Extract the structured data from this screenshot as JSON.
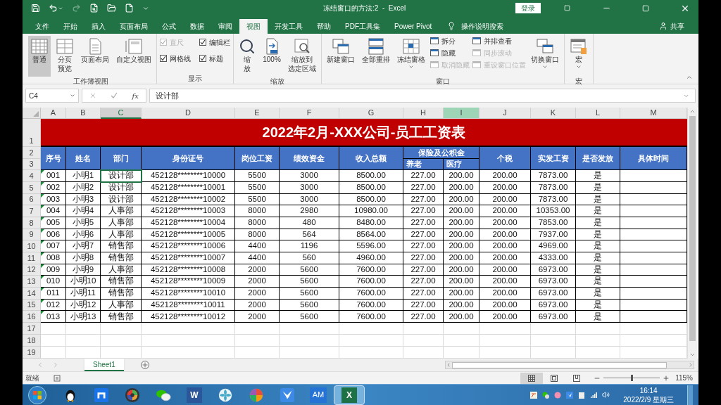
{
  "title_bar": {
    "title": "冻结窗口的方法:2  -  Excel",
    "login": "登录"
  },
  "ribbon_tabs": [
    {
      "label": "文件",
      "selected": false
    },
    {
      "label": "开始",
      "selected": false
    },
    {
      "label": "插入",
      "selected": false
    },
    {
      "label": "页面布局",
      "selected": false
    },
    {
      "label": "公式",
      "selected": false
    },
    {
      "label": "数据",
      "selected": false
    },
    {
      "label": "审阅",
      "selected": false
    },
    {
      "label": "视图",
      "selected": true
    },
    {
      "label": "开发工具",
      "selected": false
    },
    {
      "label": "帮助",
      "selected": false
    },
    {
      "label": "PDF工具集",
      "selected": false
    },
    {
      "label": "Power Pivot",
      "selected": false
    }
  ],
  "tell_me": "操作说明搜索",
  "share": "共享",
  "ribbon_groups": [
    {
      "label": "工作簿视图",
      "items": [
        {
          "kind": "large",
          "lines": [
            "普通"
          ],
          "selected": true
        },
        {
          "kind": "large",
          "lines": [
            "分页",
            "预览"
          ],
          "selected": false
        },
        {
          "kind": "large",
          "lines": [
            "页面布局"
          ],
          "selected": false
        },
        {
          "kind": "large",
          "lines": [
            "自定义视图"
          ],
          "selected": false
        }
      ]
    },
    {
      "label": "显示",
      "items": [
        {
          "kind": "check",
          "label": "直尺",
          "checked": true,
          "disabled": true
        },
        {
          "kind": "check",
          "label": "网格线",
          "checked": true,
          "disabled": false
        },
        {
          "kind": "check",
          "label": "编辑栏",
          "checked": true,
          "disabled": false
        },
        {
          "kind": "check",
          "label": "标题",
          "checked": true,
          "disabled": false
        }
      ]
    },
    {
      "label": "缩放",
      "items": [
        {
          "kind": "large",
          "lines": [
            "缩",
            "放"
          ],
          "selected": false
        },
        {
          "kind": "large",
          "lines": [
            "100%"
          ],
          "selected": false
        },
        {
          "kind": "large",
          "lines": [
            "缩放到",
            "选定区域"
          ],
          "selected": false
        }
      ]
    },
    {
      "label": "窗口",
      "items": [
        {
          "kind": "large",
          "lines": [
            "新建窗口"
          ],
          "selected": false
        },
        {
          "kind": "large",
          "lines": [
            "全部重排"
          ],
          "selected": false
        },
        {
          "kind": "large",
          "lines": [
            "冻结窗格"
          ],
          "selected": false,
          "dropdown": true
        },
        {
          "kind": "small",
          "label": "拆分",
          "disabled": false
        },
        {
          "kind": "small",
          "label": "隐藏",
          "disabled": false
        },
        {
          "kind": "small",
          "label": "取消隐藏",
          "disabled": true
        },
        {
          "kind": "small2",
          "label": "并排查看",
          "disabled": false
        },
        {
          "kind": "small2",
          "label": "同步滚动",
          "disabled": true
        },
        {
          "kind": "small2",
          "label": "重设窗口位置",
          "disabled": true
        },
        {
          "kind": "large",
          "lines": [
            "切换窗口"
          ],
          "selected": false,
          "dropdown": true
        }
      ]
    },
    {
      "label": "宏",
      "items": [
        {
          "kind": "large",
          "lines": [
            "宏"
          ],
          "selected": false,
          "dropdown": true
        }
      ]
    }
  ],
  "formula_bar": {
    "name_box": "C4",
    "function_label": "fx",
    "formula": "设计部"
  },
  "columns": [
    {
      "label": "A",
      "selected": false,
      "highlighted": false
    },
    {
      "label": "B",
      "selected": false,
      "highlighted": false
    },
    {
      "label": "C",
      "selected": true,
      "highlighted": false
    },
    {
      "label": "D",
      "selected": false,
      "highlighted": false
    },
    {
      "label": "E",
      "selected": false,
      "highlighted": false
    },
    {
      "label": "F",
      "selected": false,
      "highlighted": false
    },
    {
      "label": "G",
      "selected": false,
      "highlighted": false
    },
    {
      "label": "H",
      "selected": false,
      "highlighted": false
    },
    {
      "label": "I",
      "selected": false,
      "highlighted": true
    },
    {
      "label": "J",
      "selected": false,
      "highlighted": false
    },
    {
      "label": "K",
      "selected": false,
      "highlighted": false
    },
    {
      "label": "L",
      "selected": false,
      "highlighted": false
    },
    {
      "label": "M",
      "selected": false,
      "highlighted": false
    }
  ],
  "row_numbers": [
    "1",
    "2",
    "3",
    "4",
    "5",
    "6",
    "7",
    "8",
    "9",
    "10",
    "11",
    "12",
    "13",
    "14",
    "15",
    "16",
    "17",
    "18",
    "19"
  ],
  "sheet_title": "2022年2月-XXX公司-员工工资表",
  "header": [
    {
      "label": "序号"
    },
    {
      "label": "姓名"
    },
    {
      "label": "部门"
    },
    {
      "label": "身份证号"
    },
    {
      "label": "岗位工资"
    },
    {
      "label": "绩效资金"
    },
    {
      "label": "收入总额"
    },
    {
      "label": "保险及公积金",
      "children": [
        {
          "label": "养老"
        },
        {
          "label": "医疗"
        }
      ]
    },
    {
      "label": "个税"
    },
    {
      "label": "实发工资"
    },
    {
      "label": "是否发放"
    },
    {
      "label": "具体时间"
    }
  ],
  "rows": [
    {
      "selected": true,
      "flagged": true,
      "cells": [
        "001",
        "小明1",
        "设计部",
        "452128********10000",
        "5500",
        "3000",
        "8500.00",
        "227.00",
        "200.00",
        "200.00",
        "7873.00",
        "是"
      ]
    },
    {
      "selected": false,
      "flagged": true,
      "cells": [
        "002",
        "小明2",
        "设计部",
        "452128********10001",
        "5500",
        "3000",
        "8500.00",
        "227.00",
        "200.00",
        "200.00",
        "7873.00",
        "是"
      ]
    },
    {
      "selected": false,
      "flagged": true,
      "cells": [
        "003",
        "小明3",
        "设计部",
        "452128********10002",
        "5500",
        "3000",
        "8500.00",
        "227.00",
        "200.00",
        "200.00",
        "7873.00",
        "是"
      ]
    },
    {
      "selected": false,
      "flagged": true,
      "cells": [
        "004",
        "小明4",
        "人事部",
        "452128********10003",
        "8000",
        "2980",
        "10980.00",
        "227.00",
        "200.00",
        "200.00",
        "10353.00",
        "是"
      ]
    },
    {
      "selected": false,
      "flagged": true,
      "cells": [
        "005",
        "小明5",
        "人事部",
        "452128********10004",
        "8000",
        "480",
        "8480.00",
        "227.00",
        "200.00",
        "200.00",
        "7853.00",
        "是"
      ]
    },
    {
      "selected": false,
      "flagged": true,
      "cells": [
        "006",
        "小明6",
        "人事部",
        "452128********10005",
        "8000",
        "564",
        "8564.00",
        "227.00",
        "200.00",
        "200.00",
        "7937.00",
        "是"
      ]
    },
    {
      "selected": false,
      "flagged": true,
      "cells": [
        "007",
        "小明7",
        "销售部",
        "452128********10006",
        "4400",
        "1196",
        "5596.00",
        "227.00",
        "200.00",
        "200.00",
        "4969.00",
        "是"
      ]
    },
    {
      "selected": false,
      "flagged": true,
      "cells": [
        "008",
        "小明8",
        "销售部",
        "452128********10007",
        "4400",
        "560",
        "4960.00",
        "227.00",
        "200.00",
        "200.00",
        "4333.00",
        "是"
      ]
    },
    {
      "selected": false,
      "flagged": true,
      "cells": [
        "009",
        "小明9",
        "人事部",
        "452128********10008",
        "2000",
        "5600",
        "7600.00",
        "227.00",
        "200.00",
        "200.00",
        "6973.00",
        "是"
      ]
    },
    {
      "selected": false,
      "flagged": true,
      "cells": [
        "010",
        "小明10",
        "销售部",
        "452128********10009",
        "2000",
        "5600",
        "7600.00",
        "227.00",
        "200.00",
        "200.00",
        "6973.00",
        "是"
      ]
    },
    {
      "selected": false,
      "flagged": true,
      "cells": [
        "011",
        "小明11",
        "销售部",
        "452128********10010",
        "2000",
        "5600",
        "7600.00",
        "227.00",
        "200.00",
        "200.00",
        "6973.00",
        "是"
      ]
    },
    {
      "selected": false,
      "flagged": true,
      "cells": [
        "012",
        "小明12",
        "人事部",
        "452128********10011",
        "2000",
        "5600",
        "7600.00",
        "227.00",
        "200.00",
        "200.00",
        "6973.00",
        "是"
      ]
    },
    {
      "selected": false,
      "flagged": true,
      "cells": [
        "013",
        "小明13",
        "销售部",
        "452128********10012",
        "2000",
        "5600",
        "7600.00",
        "227.00",
        "200.00",
        "200.00",
        "6973.00",
        "是"
      ]
    }
  ],
  "sheet_tabs": [
    {
      "label": "Sheet1",
      "selected": true
    }
  ],
  "status_bar": {
    "status": "就绪",
    "views": [
      {
        "kind": "normal",
        "selected": true
      },
      {
        "kind": "page_layout",
        "selected": false
      },
      {
        "kind": "page_break",
        "selected": false
      }
    ],
    "zoom": {
      "level": 0.5,
      "reading": "115%"
    }
  },
  "taskbar": {
    "apps": [
      {
        "kind": "qq",
        "active": false
      },
      {
        "kind": "maxthon",
        "active": false
      },
      {
        "kind": "wheel",
        "active": false
      },
      {
        "kind": "wechat",
        "active": false
      },
      {
        "kind": "word",
        "label": "W",
        "active": false
      },
      {
        "kind": "flower",
        "active": false
      },
      {
        "kind": "ball",
        "active": false
      },
      {
        "kind": "bird",
        "active": false
      },
      {
        "kind": "text",
        "label": "AM",
        "active": false
      },
      {
        "kind": "excel",
        "label": "X",
        "active": true
      }
    ],
    "time": "16:14",
    "date": "2022/2/9 星期三"
  }
}
